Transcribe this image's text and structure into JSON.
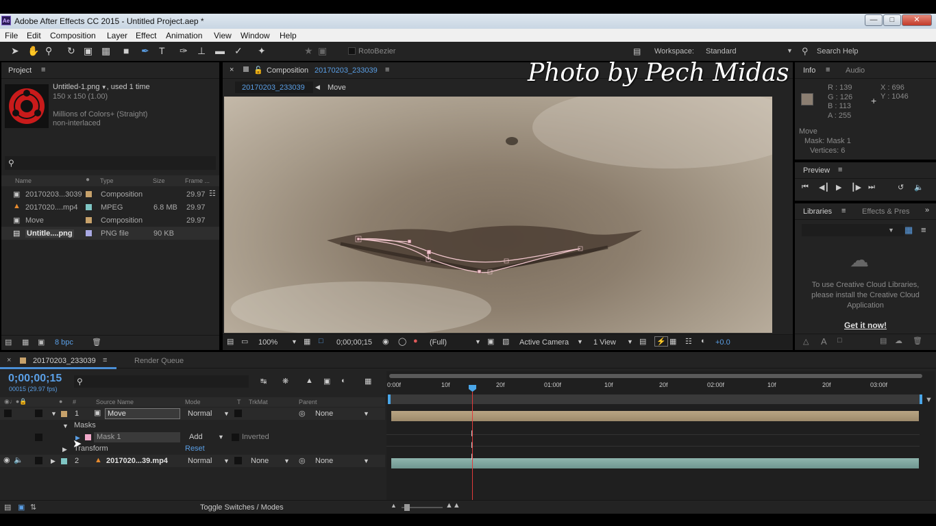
{
  "window": {
    "title": "Adobe After Effects CC 2015 - Untitled Project.aep *",
    "app_icon": "Ae"
  },
  "menu": [
    "File",
    "Edit",
    "Composition",
    "Layer",
    "Effect",
    "Animation",
    "View",
    "Window",
    "Help"
  ],
  "toolbar": {
    "rotobezier": "RotoBezier",
    "workspace_label": "Workspace:",
    "workspace_value": "Standard",
    "search_help": "Search Help"
  },
  "watermark": "Photo by Pech Midas",
  "project": {
    "panel_title": "Project",
    "selected": {
      "name": "Untitled-1.png",
      "used": ", used 1 time",
      "dims": "150 x 150 (1.00)",
      "colors": "Millions of Colors+ (Straight)",
      "interlace": "non-interlaced"
    },
    "columns": {
      "name": "Name",
      "type": "Type",
      "size": "Size",
      "frame": "Frame ..."
    },
    "items": [
      {
        "name": "20170203...3039",
        "type": "Composition",
        "size": "",
        "fps": "29.97",
        "color": "#c7a26b"
      },
      {
        "name": "2017020....mp4",
        "type": "MPEG",
        "size": "6.8 MB",
        "fps": "29.97",
        "color": "#7fc6c4"
      },
      {
        "name": "Move",
        "type": "Composition",
        "size": "",
        "fps": "29.97",
        "color": "#c7a26b"
      },
      {
        "name": "Untitle....png",
        "type": "PNG file",
        "size": "90 KB",
        "fps": "",
        "color": "#a9a9e3"
      }
    ],
    "bpc": "8 bpc"
  },
  "comp": {
    "tab_label": "Composition",
    "tab_name": "20170203_233039",
    "breadcrumb_active": "20170203_233039",
    "breadcrumb_next": "Move",
    "footer": {
      "zoom": "100%",
      "timecode": "0;00;00;15",
      "resolution": "(Full)",
      "camera": "Active Camera",
      "view": "1 View",
      "exposure": "+0.0"
    }
  },
  "info": {
    "tab_info": "Info",
    "tab_audio": "Audio",
    "r": "R : 139",
    "g": "G : 126",
    "b": "B : 113",
    "a": "A : 255",
    "x": "X : 696",
    "y": "Y : 1046",
    "move": "Move",
    "mask": "Mask: Mask 1",
    "vertices": "Vertices: 6",
    "swatch": "#8b7e71"
  },
  "preview": {
    "title": "Preview"
  },
  "libraries": {
    "tab": "Libraries",
    "tab2": "Effects & Pres",
    "message": "To use Creative Cloud Libraries, please install the Creative Cloud Application",
    "cta": "Get it now!"
  },
  "timeline": {
    "tab_comp": "20170203_233039",
    "tab_render": "Render Queue",
    "timecode": "0;00;00;15",
    "frames": "00015 (29.97 fps)",
    "columns": {
      "source": "Source Name",
      "mode": "Mode",
      "t": "T",
      "trkmat": "TrkMat",
      "parent": "Parent"
    },
    "ruler": [
      "0:00f",
      "10f",
      "20f",
      "01:00f",
      "10f",
      "20f",
      "02:00f",
      "10f",
      "20f",
      "03:00f"
    ],
    "layer1": {
      "num": "1",
      "name": "Move",
      "mode": "Normal",
      "parent": "None",
      "color": "#c7a26b"
    },
    "masks_label": "Masks",
    "mask1": {
      "name": "Mask 1",
      "mode": "Add",
      "inverted": "Inverted",
      "color": "#f0a8c8"
    },
    "transform": {
      "label": "Transform",
      "reset": "Reset"
    },
    "layer2": {
      "num": "2",
      "name": "2017020...39.mp4",
      "mode": "Normal",
      "trkmat": "None",
      "parent": "None",
      "color": "#7fc6c4"
    },
    "toggle": "Toggle Switches / Modes"
  }
}
